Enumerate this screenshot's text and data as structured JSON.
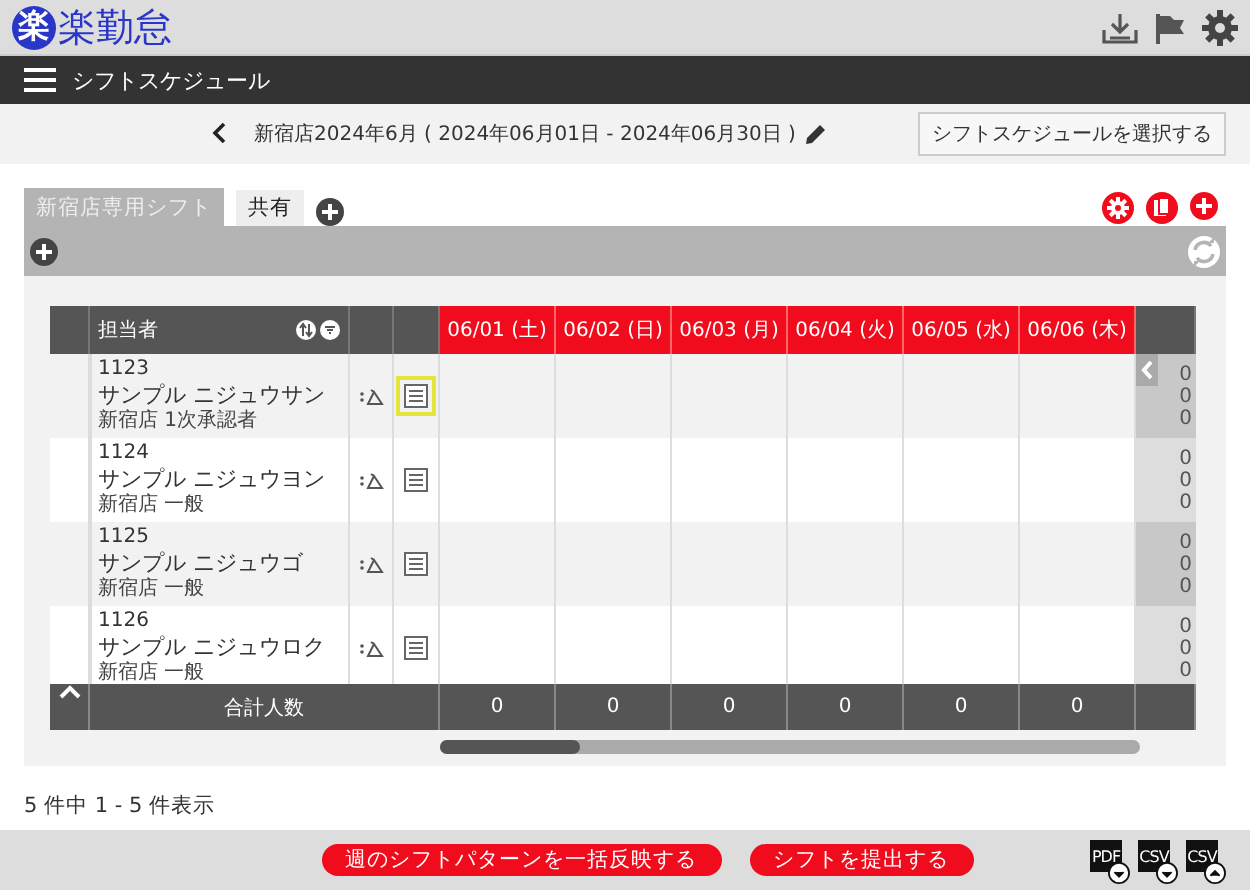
{
  "app": {
    "logo_mark": "楽",
    "logo_text": "楽勤怠"
  },
  "nav": {
    "title": "シフトスケジュール"
  },
  "schedule": {
    "title": "新宿店2024年6月 ( 2024年06月01日 - 2024年06月30日 )",
    "select_button": "シフトスケジュールを選択する"
  },
  "tabs": [
    {
      "label": "新宿店専用シフト",
      "selected": true
    },
    {
      "label": "共有",
      "selected": false
    }
  ],
  "table": {
    "header": "担当者",
    "dates": [
      "06/01 (土)",
      "06/02 (日)",
      "06/03 (月)",
      "06/04 (火)",
      "06/05 (水)",
      "06/06 (木)"
    ],
    "rows": [
      {
        "id": "1123",
        "name": "サンプル ニジュウサン",
        "role": "新宿店 1次承認者",
        "highlighted": true,
        "totals": [
          "0",
          "0",
          "0"
        ]
      },
      {
        "id": "1124",
        "name": "サンプル ニジュウヨン",
        "role": "新宿店 一般",
        "highlighted": false,
        "totals": [
          "0",
          "0",
          "0"
        ]
      },
      {
        "id": "1125",
        "name": "サンプル ニジュウゴ",
        "role": "新宿店 一般",
        "highlighted": false,
        "totals": [
          "0",
          "0",
          "0"
        ]
      },
      {
        "id": "1126",
        "name": "サンプル ニジュウロク",
        "role": "新宿店 一般",
        "highlighted": false,
        "totals": [
          "0",
          "0",
          "0"
        ]
      }
    ],
    "footer_label": "合計人数",
    "footer_values": [
      "0",
      "0",
      "0",
      "0",
      "0",
      "0"
    ]
  },
  "pagination": "5 件中 1 - 5 件表示",
  "buttons": [
    "週のシフトパターンを一括反映する",
    "シフトを提出する"
  ],
  "exports": [
    {
      "label": "PDF",
      "kind": "download"
    },
    {
      "label": "CSV",
      "kind": "download"
    },
    {
      "label": "CSV",
      "kind": "upload"
    }
  ]
}
